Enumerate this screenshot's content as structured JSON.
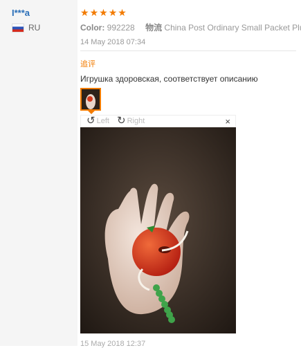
{
  "user": {
    "name": "I***a",
    "country": "RU"
  },
  "review": {
    "rating": 5,
    "color_label": "Color:",
    "color_value": "992228",
    "shipping_label": "物流",
    "shipping_value": "China Post Ordinary Small Packet Plus",
    "date": "14 May 2018 07:34",
    "section_label": "追评",
    "text": "Игрушка здоровская, соответствует описанию",
    "next_date": "15 May 2018 12:37"
  },
  "viewer": {
    "rotate_left": "Left",
    "rotate_right": "Right",
    "close": "×"
  },
  "colors": {
    "accent": "#f27b00",
    "link": "#2a6fb8",
    "divider": "#e5e5e5"
  },
  "icons": [
    "star-icon",
    "rotate-left-icon",
    "rotate-right-icon",
    "close-icon",
    "flag-icon"
  ]
}
